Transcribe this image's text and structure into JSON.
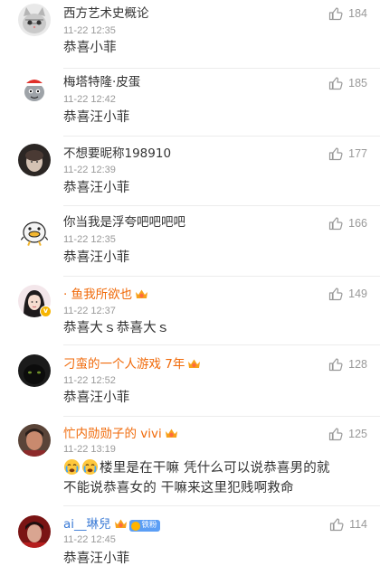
{
  "comments": [
    {
      "name": "西方艺术史概论",
      "time": "11-22 12:35",
      "text": "恭喜小菲",
      "likes": "184",
      "avatar_icon": "cat-icon"
    },
    {
      "name": "梅塔特隆·皮蛋",
      "time": "11-22 12:42",
      "text": "恭喜汪小菲",
      "likes": "185",
      "avatar_icon": "cartoon-dog-icon"
    },
    {
      "name": "不想要昵称198910",
      "time": "11-22 12:39",
      "text": "恭喜汪小菲",
      "likes": "177",
      "avatar_icon": "photo-avatar-icon"
    },
    {
      "name": "你当我是浮夸吧吧吧吧",
      "time": "11-22 12:35",
      "text": "恭喜汪小菲",
      "likes": "166",
      "avatar_icon": "duck-icon"
    },
    {
      "name": "· 鱼我所欲也",
      "time": "11-22 12:37",
      "text": "恭喜大ｓ恭喜大ｓ",
      "likes": "149",
      "avatar_icon": "girl-avatar-icon"
    },
    {
      "name": "刁蛮的一个人游戏 7年",
      "time": "11-22 12:52",
      "text": "恭喜汪小菲",
      "likes": "128",
      "avatar_icon": "black-cat-icon"
    },
    {
      "name": "忙内勋勋子的 vivi",
      "time": "11-22 13:19",
      "text_line1": "楼里是在干嘛  凭什么可以说恭喜男的就",
      "text_line2": "不能说恭喜女的  干嘛来这里犯贱啊救命",
      "likes": "125",
      "avatar_icon": "person-avatar-icon"
    },
    {
      "name": "ai__琳兒",
      "time": "11-22 12:45",
      "text": "恭喜汪小菲",
      "likes": "114",
      "avatar_icon": "red-avatar-icon",
      "badge": "铁粉"
    }
  ],
  "colors": {
    "name": "#333333",
    "vip_name": "#f06a0a",
    "time": "#9a9a9a",
    "like": "#999999",
    "divider": "#ececec"
  }
}
